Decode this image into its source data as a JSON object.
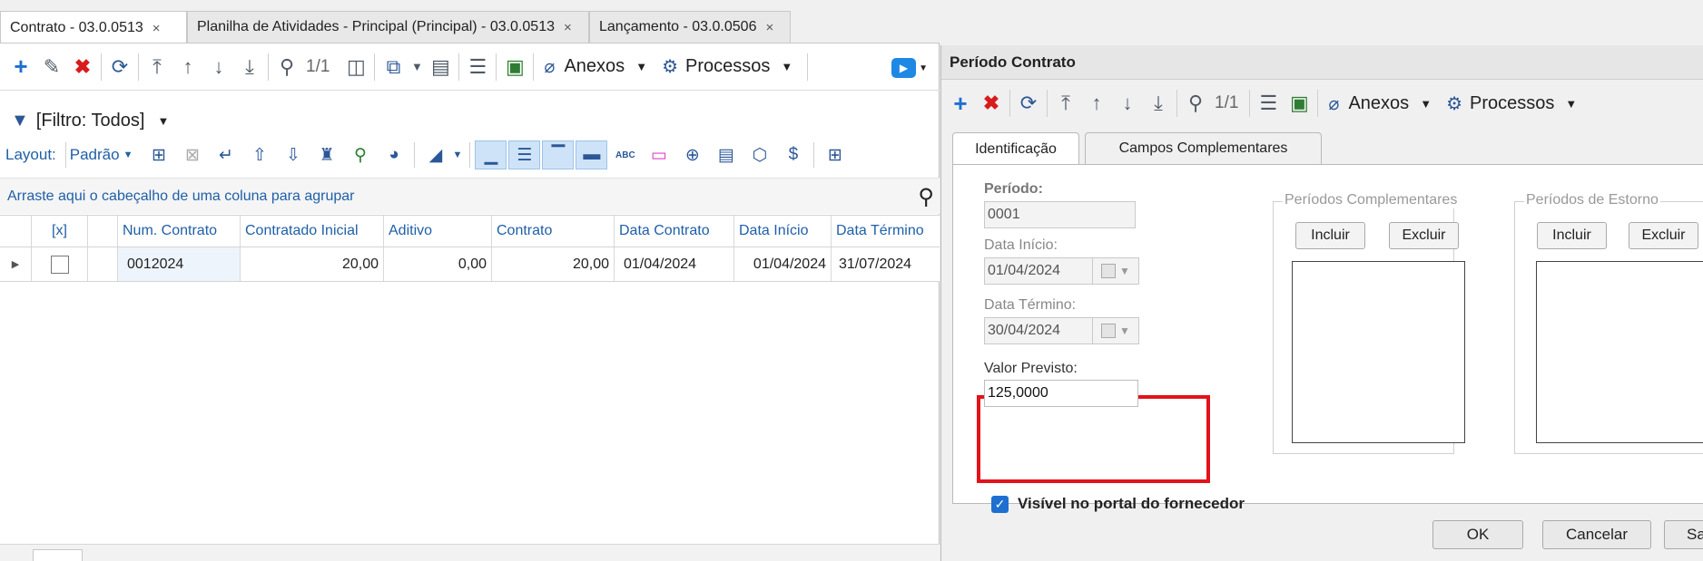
{
  "tabs": [
    {
      "label": "Contrato - 03.0.0513",
      "close": "×"
    },
    {
      "label": "Planilha de Atividades - Principal (Principal) - 03.0.0513",
      "close": "×"
    },
    {
      "label": "Lançamento - 03.0.0506",
      "close": "×"
    }
  ],
  "toolbar": {
    "page_indicator": "1/1",
    "attachments_label": "Anexos",
    "processes_label": "Processos"
  },
  "filter": {
    "label": "[Filtro: Todos]"
  },
  "layout": {
    "label": "Layout:",
    "value": "Padrão"
  },
  "group_hint": "Arraste aqui o cabeçalho de uma coluna para agrupar",
  "grid": {
    "columns": [
      "[x]",
      "Num. Contrato",
      "Contratado Inicial",
      "Aditivo",
      "Contrato",
      "Data Contrato",
      "Data Início",
      "Data Término"
    ],
    "rows": [
      {
        "num_contrato": "0012024",
        "contratado_inicial": "20,00",
        "aditivo": "0,00",
        "contrato": "20,00",
        "data_contrato": "01/04/2024",
        "data_inicio": "01/04/2024",
        "data_termino": "31/07/2024"
      }
    ]
  },
  "dialog": {
    "title": "Período Contrato",
    "page_indicator": "1/1",
    "attachments_label": "Anexos",
    "processes_label": "Processos",
    "tabs": [
      "Identificação",
      "Campos Complementares"
    ],
    "fields": {
      "periodo_label": "Período:",
      "periodo_value": "0001",
      "data_inicio_label": "Data Início:",
      "data_inicio_value": "01/04/2024",
      "data_termino_label": "Data Término:",
      "data_termino_value": "30/04/2024",
      "valor_previsto_label": "Valor Previsto:",
      "valor_previsto_value": "125,0000"
    },
    "periodos_complementares": {
      "legend": "Períodos Complementares",
      "incluir": "Incluir",
      "excluir": "Excluir"
    },
    "periodos_estorno": {
      "legend": "Períodos de Estorno",
      "incluir": "Incluir",
      "excluir": "Excluir"
    },
    "visivel_label": "Visível no portal do fornecedor",
    "buttons": {
      "ok": "OK",
      "cancelar": "Cancelar",
      "salvar": "Salv"
    }
  },
  "colors": {
    "highlight": "#e3121b",
    "accent": "#1e6fd0",
    "link": "#1f5fa8"
  }
}
